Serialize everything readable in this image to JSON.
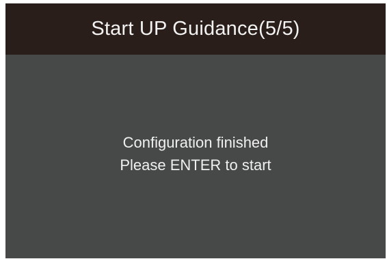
{
  "header": {
    "title": "Start UP Guidance(5/5)"
  },
  "message": {
    "line1": "Configuration finished",
    "line2": "Please ENTER to start"
  },
  "colors": {
    "header_bg": "#2a1e1a",
    "panel_bg": "#474848",
    "text": "#f0f0f0"
  }
}
